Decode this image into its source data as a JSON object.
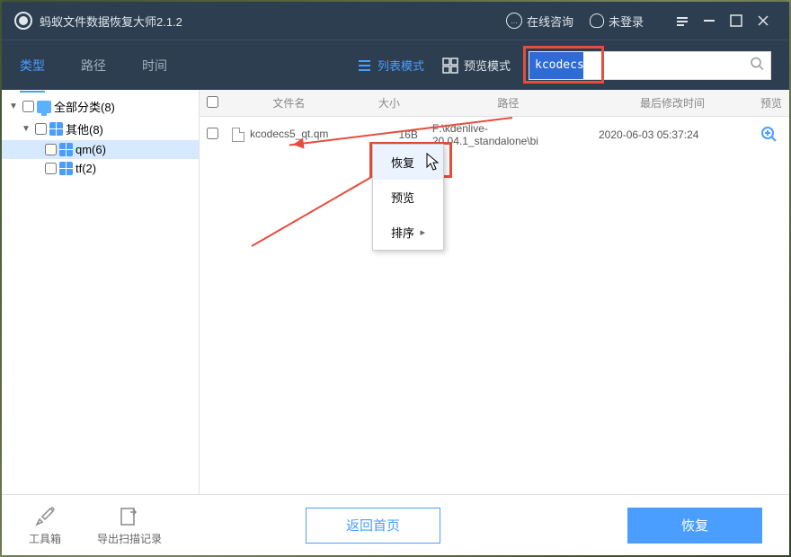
{
  "title": "蚂蚁文件数据恢复大师2.1.2",
  "header": {
    "consult": "在线咨询",
    "login": "未登录"
  },
  "tabs": {
    "type": "类型",
    "path": "路径",
    "time": "时间"
  },
  "views": {
    "list": "列表模式",
    "preview": "预览模式"
  },
  "search": {
    "value": "kcodecs"
  },
  "tree": {
    "all": "全部分类(8)",
    "other": "其他(8)",
    "qm": "qm(6)",
    "tf": "tf(2)"
  },
  "columns": {
    "name": "文件名",
    "size": "大小",
    "path": "路径",
    "time": "最后修改时间",
    "preview": "预览"
  },
  "row": {
    "name": "kcodecs5_qt.qm",
    "size": "16B",
    "path": "F:\\kdenlive-20.04.1_standalone\\bi",
    "time": "2020-06-03 05:37:24"
  },
  "ctx": {
    "recover": "恢复",
    "preview": "预览",
    "sort": "排序"
  },
  "footer": {
    "toolbox": "工具箱",
    "export": "导出扫描记录",
    "home": "返回首页",
    "recover": "恢复"
  }
}
